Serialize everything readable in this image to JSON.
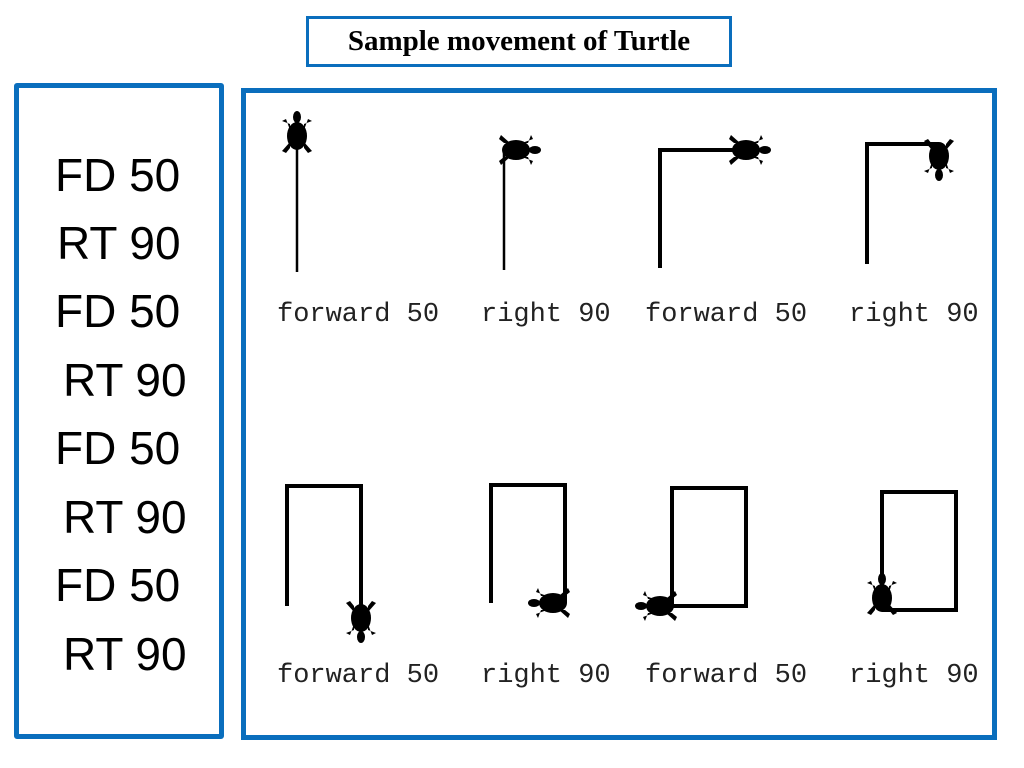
{
  "title": "Sample movement of Turtle",
  "commands": [
    "FD 50",
    "RT 90",
    "FD 50",
    "RT 90",
    "FD 50",
    "RT 90",
    "FD 50",
    "RT 90"
  ],
  "steps": [
    {
      "label": "forward 50",
      "heading": "up",
      "segments_drawn": 1
    },
    {
      "label": "right 90",
      "heading": "right",
      "segments_drawn": 1
    },
    {
      "label": "forward 50",
      "heading": "right",
      "segments_drawn": 2
    },
    {
      "label": "right 90",
      "heading": "down",
      "segments_drawn": 2
    },
    {
      "label": "forward 50",
      "heading": "down",
      "segments_drawn": 3
    },
    {
      "label": "right 90",
      "heading": "left",
      "segments_drawn": 3
    },
    {
      "label": "forward 50",
      "heading": "left",
      "segments_drawn": 4
    },
    {
      "label": "right 90",
      "heading": "up",
      "segments_drawn": 4
    }
  ],
  "colors": {
    "border": "#0a6ebd",
    "line": "#000000"
  }
}
